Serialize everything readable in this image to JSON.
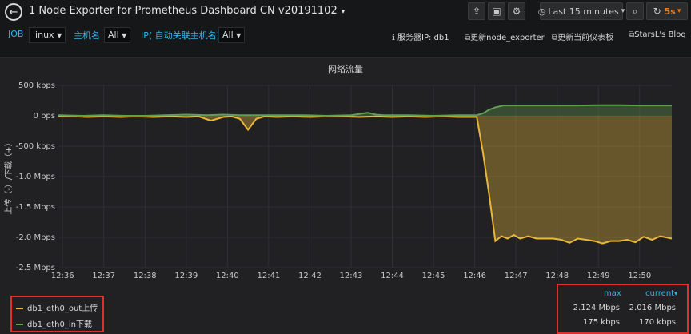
{
  "header": {
    "back_icon": "←",
    "title": "1 Node Exporter for Prometheus Dashboard CN v20191102",
    "title_caret": "▾",
    "share_icon": "⇪",
    "save_icon": "▣",
    "settings_icon": "⚙",
    "time_range": "Last 15 minutes",
    "time_icon": "◷",
    "time_caret": "▾",
    "zoom_icon": "⌕",
    "refresh_icon": "↻",
    "refresh_interval": "5s",
    "refresh_caret": "▾"
  },
  "variables": [
    {
      "label": "JOB",
      "value": "linux"
    },
    {
      "label": "主机名",
      "value": "All"
    },
    {
      "label": "IP( 自动关联主机名)",
      "value": "All"
    }
  ],
  "links": {
    "info_icon": "ℹ",
    "server_ip_label": "服务器IP:",
    "server_ip_value": "db1",
    "ext_icon": "⧉",
    "update_exporter": "更新node_exporter",
    "update_dashboard": "更新当前仪表板",
    "blog": "StarsL's Blog"
  },
  "panel": {
    "title": "网络流量"
  },
  "legend": {
    "col_max": "max",
    "col_current": "current",
    "sort_icon": "▾",
    "items": [
      {
        "name": "db1_eth0_out上传",
        "color": "#eab839",
        "max": "2.124 Mbps",
        "current": "2.016 Mbps"
      },
      {
        "name": "db1_eth0_in下载",
        "color": "#629e51",
        "max": "175 kbps",
        "current": "170 kbps"
      }
    ]
  },
  "chart_data": {
    "type": "area",
    "title": "网络流量",
    "ylabel": "上传（-）/下载（+）",
    "ylim": [
      -2.5,
      0.5
    ],
    "y_unit": "Mbps",
    "y_ticks": [
      0.5,
      0,
      -0.5,
      -1.0,
      -1.5,
      -2.0,
      -2.5
    ],
    "y_tick_labels": [
      "500 kbps",
      "0 bps",
      "-500 kbps",
      "-1.0 Mbps",
      "-1.5 Mbps",
      "-2.0 Mbps",
      "-2.5 Mbps"
    ],
    "x_tick_labels": [
      "12:36",
      "12:37",
      "12:38",
      "12:39",
      "12:40",
      "12:41",
      "12:42",
      "12:43",
      "12:44",
      "12:45",
      "12:46",
      "12:47",
      "12:48",
      "12:49",
      "12:50"
    ],
    "x_range_minutes": [
      -0.1,
      14.78
    ],
    "series": [
      {
        "name": "db1_eth0_out上传",
        "color": "#eab839",
        "x": [
          -0.1,
          0.3,
          0.6,
          1.0,
          1.4,
          1.8,
          2.2,
          2.6,
          3.0,
          3.3,
          3.6,
          3.9,
          4.1,
          4.3,
          4.5,
          4.7,
          4.9,
          5.2,
          5.6,
          6.0,
          6.4,
          6.8,
          7.2,
          7.6,
          8.0,
          8.4,
          8.8,
          9.2,
          9.6,
          9.9,
          10.05,
          10.2,
          10.35,
          10.5,
          10.65,
          10.8,
          10.95,
          11.1,
          11.3,
          11.5,
          11.7,
          11.9,
          12.1,
          12.3,
          12.5,
          12.7,
          12.9,
          13.1,
          13.3,
          13.5,
          13.7,
          13.9,
          14.1,
          14.3,
          14.5,
          14.78
        ],
        "y": [
          -0.01,
          -0.01,
          -0.02,
          -0.01,
          -0.02,
          -0.01,
          -0.02,
          -0.01,
          -0.02,
          -0.01,
          -0.08,
          -0.02,
          -0.01,
          -0.05,
          -0.23,
          -0.05,
          -0.01,
          -0.02,
          -0.01,
          -0.02,
          -0.01,
          -0.01,
          -0.02,
          -0.01,
          -0.02,
          -0.01,
          -0.02,
          -0.01,
          -0.02,
          -0.02,
          -0.02,
          -0.6,
          -1.3,
          -2.06,
          -1.98,
          -2.02,
          -1.96,
          -2.02,
          -1.98,
          -2.02,
          -2.02,
          -2.02,
          -2.04,
          -2.09,
          -2.02,
          -2.04,
          -2.06,
          -2.1,
          -2.06,
          -2.06,
          -2.04,
          -2.08,
          -1.99,
          -2.04,
          -1.98,
          -2.02
        ]
      },
      {
        "name": "db1_eth0_in下载",
        "color": "#629e51",
        "x": [
          -0.1,
          0.5,
          1.0,
          1.5,
          2.0,
          2.5,
          3.0,
          3.5,
          3.9,
          4.3,
          4.7,
          5.2,
          5.8,
          6.4,
          7.0,
          7.4,
          7.6,
          7.8,
          8.4,
          9.0,
          9.6,
          10.05,
          10.2,
          10.35,
          10.5,
          10.7,
          11.0,
          11.5,
          12.0,
          12.5,
          13.0,
          13.5,
          14.0,
          14.5,
          14.78
        ],
        "y": [
          0.01,
          0.0,
          0.01,
          0.0,
          0.0,
          0.01,
          0.02,
          0.01,
          0.02,
          0.01,
          0.01,
          0.01,
          0.01,
          0.0,
          0.01,
          0.05,
          0.02,
          0.01,
          0.01,
          0.0,
          0.01,
          0.01,
          0.04,
          0.1,
          0.14,
          0.17,
          0.17,
          0.17,
          0.17,
          0.17,
          0.175,
          0.175,
          0.17,
          0.17,
          0.17
        ]
      }
    ]
  }
}
